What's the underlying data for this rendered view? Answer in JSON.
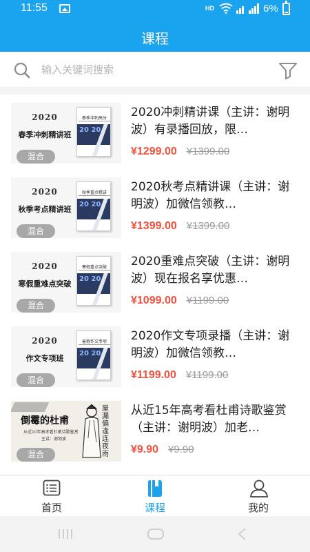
{
  "status_bar": {
    "time": "11:55",
    "network": "HD",
    "battery": "6%"
  },
  "header": {
    "title": "课程"
  },
  "search": {
    "placeholder": "输入关键词搜索"
  },
  "courses": [
    {
      "name": "2020冲刺精讲课（主讲：谢明波）有录播回放，限…",
      "price": "¥1299.00",
      "original_price": "¥1399.00",
      "badge": "混合",
      "thumb_year": "2020",
      "thumb_title": "春季冲刺精讲班",
      "book_title": "春季冲刺高分",
      "book_band": "20 20"
    },
    {
      "name": "2020秋考点精讲课（主讲：谢明波）加微信领教…",
      "price": "¥1399.00",
      "original_price": "¥1399.00",
      "badge": "混合",
      "thumb_year": "2020",
      "thumb_title": "秋季考点精讲班",
      "book_title": "秋季重点精讲",
      "book_band": "20 20"
    },
    {
      "name": "2020重难点突破（主讲：谢明波）现在报名享优惠…",
      "price": "¥1099.00",
      "original_price": "¥1199.00",
      "badge": "混合",
      "thumb_year": "2020",
      "thumb_title": "寒假重难点突破",
      "book_title": "寒假重点突破",
      "book_band": "20 20"
    },
    {
      "name": "2020作文专项录播（主讲：谢明波）加微信领教…",
      "price": "¥1199.00",
      "original_price": "¥1199.00",
      "badge": "混合",
      "thumb_year": "2020",
      "thumb_title": "作文专项班",
      "book_title": "暑假作文专项",
      "book_band": "20 20"
    },
    {
      "name": "从近15年高考看杜甫诗歌鉴赏（主讲：谢明波）加老…",
      "price": "¥9.90",
      "original_price": "¥9.90",
      "badge": "混合",
      "thumb_title": "倒霉的杜甫",
      "thumb_sub": "从近10年高考看杜甫诗歌鉴赏",
      "thumb_by": "主讲：谢明波",
      "thumb_vertical": "屋漏偏逢连夜雨"
    }
  ],
  "tabs": [
    {
      "label": "首页",
      "icon": "home-list-icon"
    },
    {
      "label": "课程",
      "icon": "book-icon"
    },
    {
      "label": "我的",
      "icon": "person-icon"
    }
  ],
  "colors": {
    "brand": "#1aa3ef",
    "price": "#f2503c",
    "badge": "#a8a8a8"
  }
}
